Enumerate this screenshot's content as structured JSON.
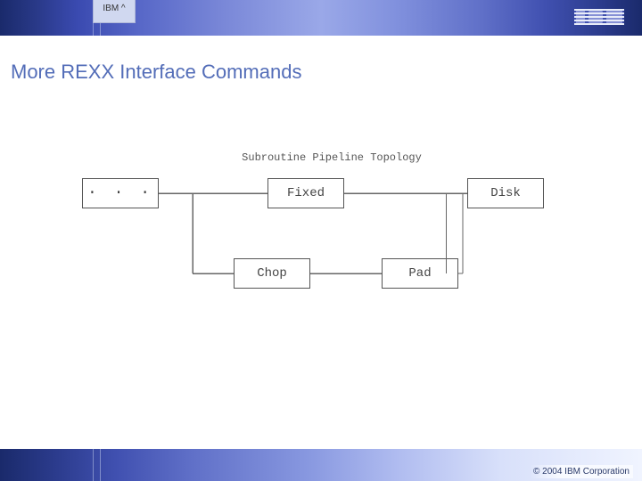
{
  "header": {
    "tab_label": "IBM ^",
    "logo_label": "IBM"
  },
  "slide": {
    "title": "More REXX Interface Commands"
  },
  "diagram": {
    "title": "Subroutine Pipeline Topology",
    "boxes": {
      "ellipsis": "· · ·",
      "fixed": "Fixed",
      "disk": "Disk",
      "chop": "Chop",
      "pad": "Pad"
    }
  },
  "footer": {
    "copyright": "© 2004 IBM Corporation"
  }
}
